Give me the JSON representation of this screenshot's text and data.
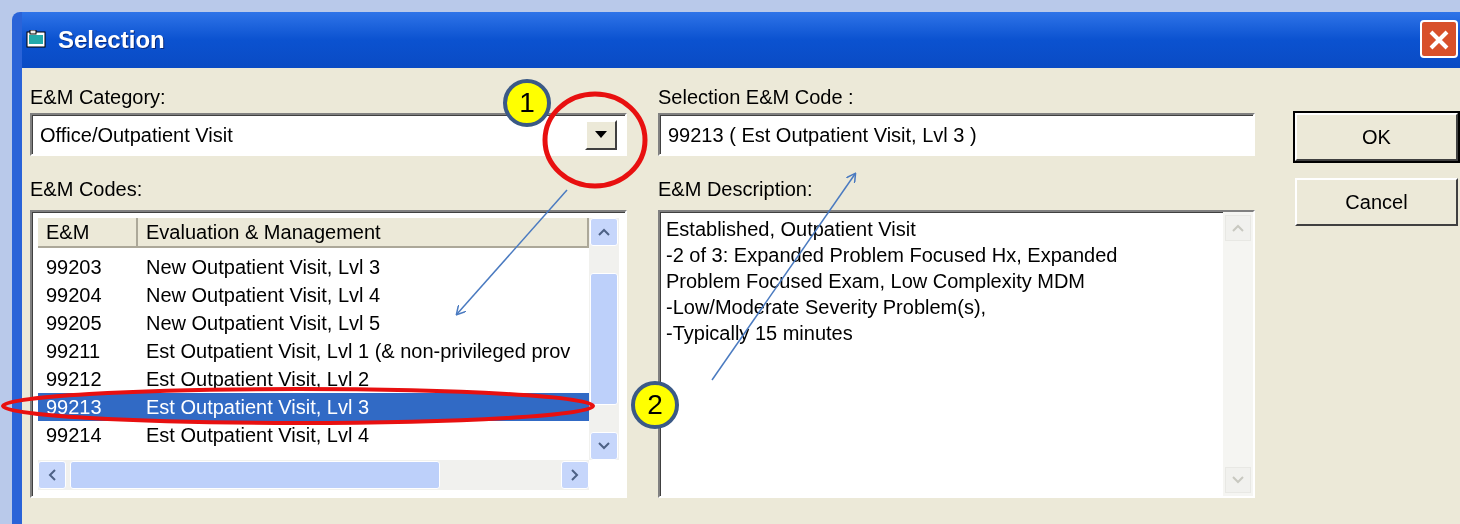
{
  "window": {
    "title": "Selection"
  },
  "category": {
    "label": "E&M Category:",
    "value": "Office/Outpatient Visit"
  },
  "codes": {
    "label": "E&M Codes:",
    "columns": [
      "E&M",
      "Evaluation & Management"
    ],
    "rows": [
      {
        "code": "99203",
        "description": "New Outpatient Visit, Lvl 3",
        "selected": false
      },
      {
        "code": "99204",
        "description": "New Outpatient Visit, Lvl 4",
        "selected": false
      },
      {
        "code": "99205",
        "description": "New Outpatient Visit, Lvl 5",
        "selected": false
      },
      {
        "code": "99211",
        "description": "Est Outpatient Visit, Lvl 1 (& non-privileged prov",
        "selected": false
      },
      {
        "code": "99212",
        "description": "Est Outpatient Visit, Lvl 2",
        "selected": false
      },
      {
        "code": "99213",
        "description": "Est Outpatient Visit, Lvl 3",
        "selected": true
      },
      {
        "code": "99214",
        "description": "Est Outpatient Visit, Lvl 4",
        "selected": false
      }
    ]
  },
  "selection_code": {
    "label": "Selection E&M Code :",
    "value": "99213 (  Est Outpatient Visit, Lvl 3 )"
  },
  "description": {
    "label": "E&M Description:",
    "lines": [
      "Established, Outpatient Visit",
      "-2 of 3: Expanded Problem Focused Hx, Expanded Problem Focused Exam, Low Complexity MDM",
      "-Low/Moderate Severity Problem(s),",
      "-Typically 15 minutes"
    ]
  },
  "buttons": [
    "OK",
    "Cancel"
  ],
  "callouts": [
    {
      "number": "1"
    },
    {
      "number": "2"
    }
  ]
}
